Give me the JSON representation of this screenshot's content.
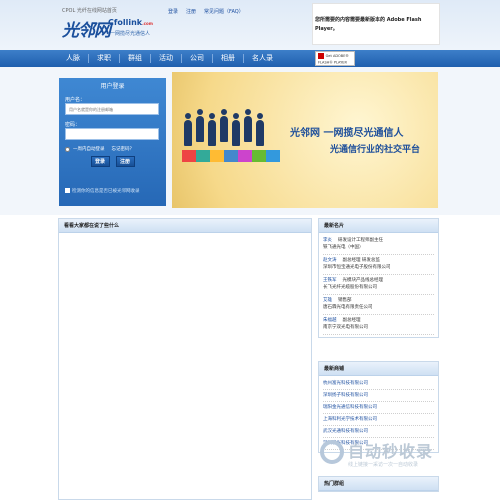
{
  "header": {
    "tagline": "CPOL 光纤在线网站首页",
    "logo_cn": "光邻网",
    "logo_en": "Cfollink",
    "logo_domain": ".com",
    "logo_slogan": "一网揽尽光通信人",
    "links": [
      "登录",
      "注册",
      "常见问题（FAQ）"
    ],
    "flash_note": "您所需要的内容需要最新版本的 Adobe Flash Player。"
  },
  "nav": {
    "items": [
      "人脉",
      "求职",
      "群组",
      "活动",
      "公司",
      "相册",
      "名人录"
    ],
    "flash_badge": "Get ADOBE® FLASH® PLAYER"
  },
  "login": {
    "title": "用户登录",
    "username_label": "用户名：",
    "username_placeholder": "用户名就是你的注册邮箱",
    "password_label": "密码：",
    "remember_label": "一周内自动登录",
    "forgot_label": "忘记密码？",
    "login_button": "登录",
    "register_button": "注册",
    "note": "检测你的信息是否已被光邻网收录"
  },
  "banner": {
    "text1": "光邻网  一网揽尽光通信人",
    "text2": "光通信行业的社交平台"
  },
  "main": {
    "heading": "看看大家都在说了些什么"
  },
  "sidebar": {
    "famous_title": "最新名片",
    "people": [
      {
        "name": "李炎",
        "title": "研发设计工程师副主任",
        "company": "铁飞通光电（中国）"
      },
      {
        "name": "赵文涛",
        "title": "副总经理 研发总监",
        "company": "深圳市恒宝通光电子股份有限公司"
      },
      {
        "name": "王铁军",
        "title": "光模块产品线总经理",
        "company": "长飞光纤光缆股份有限公司"
      },
      {
        "name": "艾雄",
        "title": "销售部",
        "company": "唐石霖光电有限责任公司"
      },
      {
        "name": "朱福越",
        "title": "副总经理",
        "company": "南京宁双光电有限公司"
      }
    ],
    "companies_title": "最新商铺",
    "companies": [
      "杭州富光科技有限公司",
      "深圳扬子科技有限公司",
      "瑞阳金光通信科技有限公司",
      "上海科利光学技术有限公司",
      "武汉光通科技有限公司",
      "深圳珑光科技有限公司"
    ],
    "hot_title": "热门群组"
  },
  "watermark": {
    "text": "自动秒收录",
    "sub": "线上链接一采访一次一自动收录"
  },
  "colors": {
    "nav": "#2a6bba",
    "login_panel": "#3178c6",
    "link": "#1d4fa0",
    "banner_bg": "#f6d98a"
  }
}
